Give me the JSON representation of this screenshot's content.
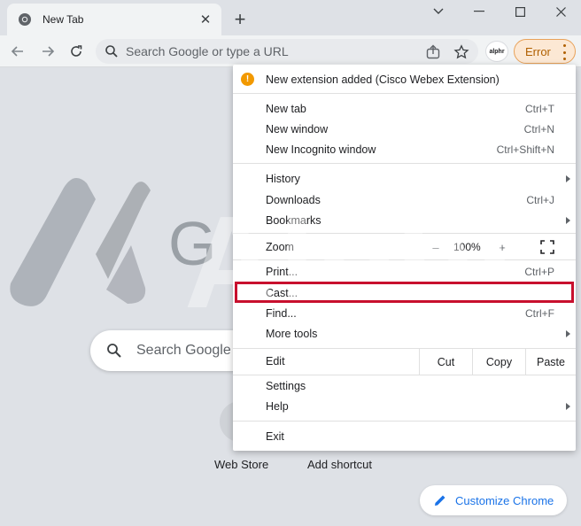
{
  "colors": {
    "accent": "#1a73e8",
    "error_fg": "#b06000",
    "error_bg": "#fce8d4",
    "highlight": "#c8102e",
    "warning": "#f29900"
  },
  "tab": {
    "title": "New Tab",
    "favicon": "chrome-icon"
  },
  "toolbar": {
    "omnibox_placeholder": "Search Google or type a URL",
    "profile_label": "alphr",
    "error_label": "Error"
  },
  "page": {
    "search_placeholder": "Search Google",
    "shortcuts": [
      "Web Store",
      "Add shortcut"
    ],
    "customize_label": "Customize Chrome",
    "logo_partial": "G"
  },
  "menu": {
    "notice": "New extension added (Cisco Webex Extension)",
    "items": {
      "new_tab": {
        "label": "New tab",
        "shortcut": "Ctrl+T"
      },
      "new_window": {
        "label": "New window",
        "shortcut": "Ctrl+N"
      },
      "new_incognito": {
        "label": "New Incognito window",
        "shortcut": "Ctrl+Shift+N"
      },
      "history": {
        "label": "History"
      },
      "downloads": {
        "label": "Downloads",
        "shortcut": "Ctrl+J"
      },
      "bookmarks": {
        "label": "Bookmarks"
      },
      "zoom": {
        "label": "Zoom",
        "minus": "–",
        "value": "100%",
        "plus": "+"
      },
      "print": {
        "label": "Print...",
        "shortcut": "Ctrl+P"
      },
      "cast": {
        "label": "Cast..."
      },
      "find": {
        "label": "Find...",
        "shortcut": "Ctrl+F"
      },
      "more_tools": {
        "label": "More tools"
      },
      "edit": {
        "label": "Edit",
        "cut": "Cut",
        "copy": "Copy",
        "paste": "Paste"
      },
      "settings": {
        "label": "Settings"
      },
      "help": {
        "label": "Help"
      },
      "exit": {
        "label": "Exit"
      }
    }
  },
  "watermark": {
    "text": "Alphr"
  }
}
